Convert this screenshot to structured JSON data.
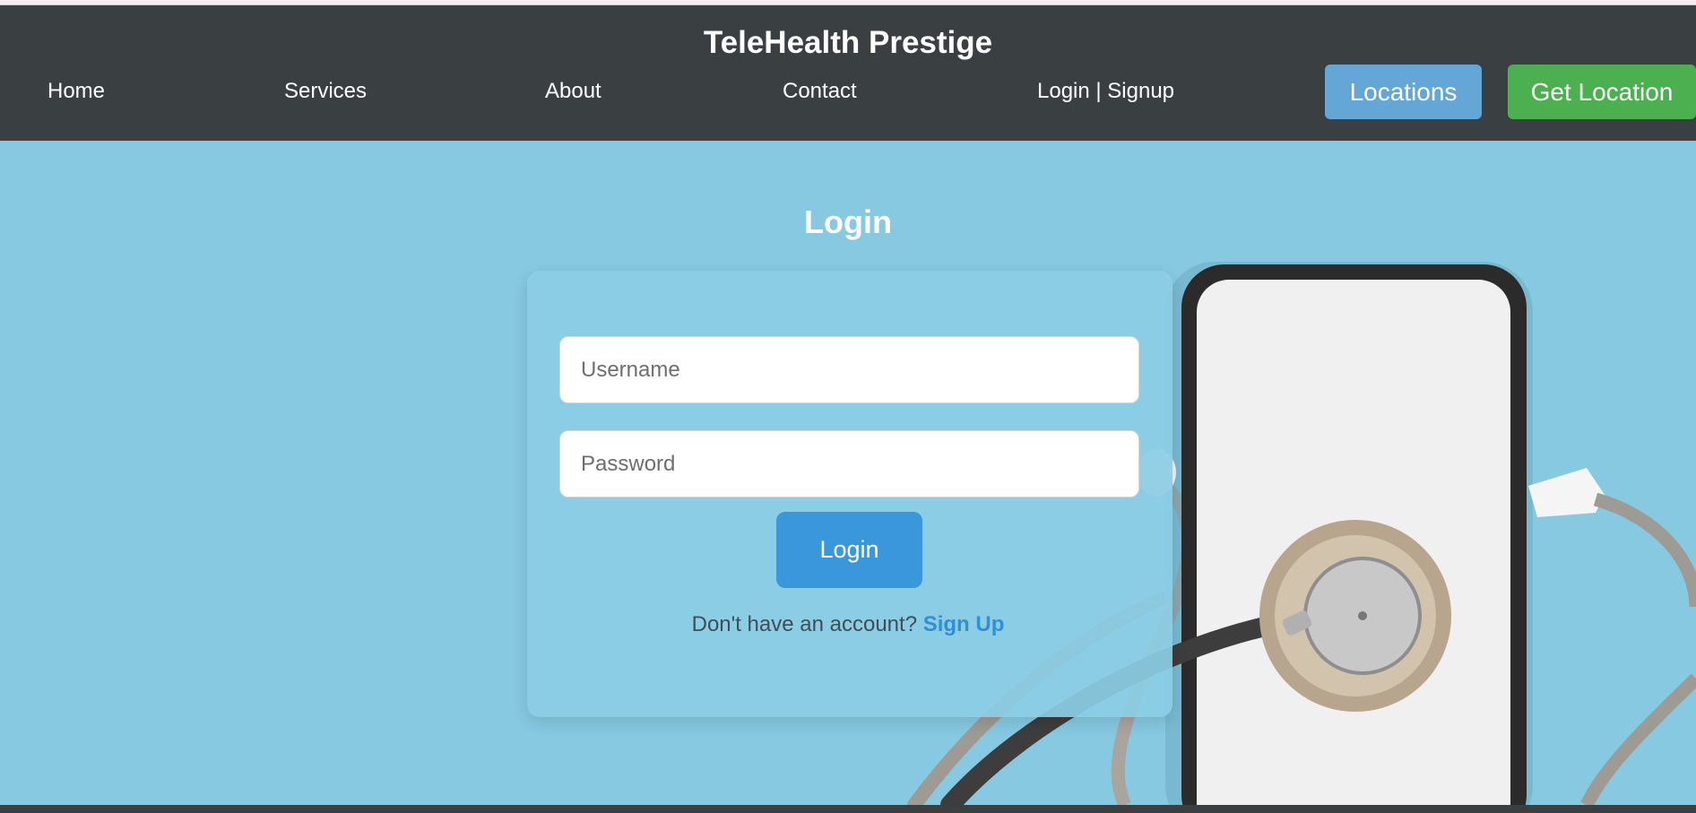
{
  "brand": "TeleHealth Prestige",
  "nav": {
    "home": "Home",
    "services": "Services",
    "about": "About",
    "contact": "Contact",
    "login_signup": "Login | Signup",
    "locations_button": "Locations",
    "get_location_button": "Get Location"
  },
  "login": {
    "title": "Login",
    "username_placeholder": "Username",
    "password_placeholder": "Password",
    "submit_label": "Login",
    "no_account_text": "Don't have an account?",
    "signup_link": "Sign Up"
  },
  "colors": {
    "navbar": "#3a4042",
    "hero_background": "#86c9e1",
    "locations_button": "#64a6d5",
    "get_location_button": "#4caf50",
    "login_button": "#3a97dc",
    "signup_link": "#2f8fd8"
  },
  "icons": {
    "hero_image": "phone-with-stethoscope-illustration"
  }
}
